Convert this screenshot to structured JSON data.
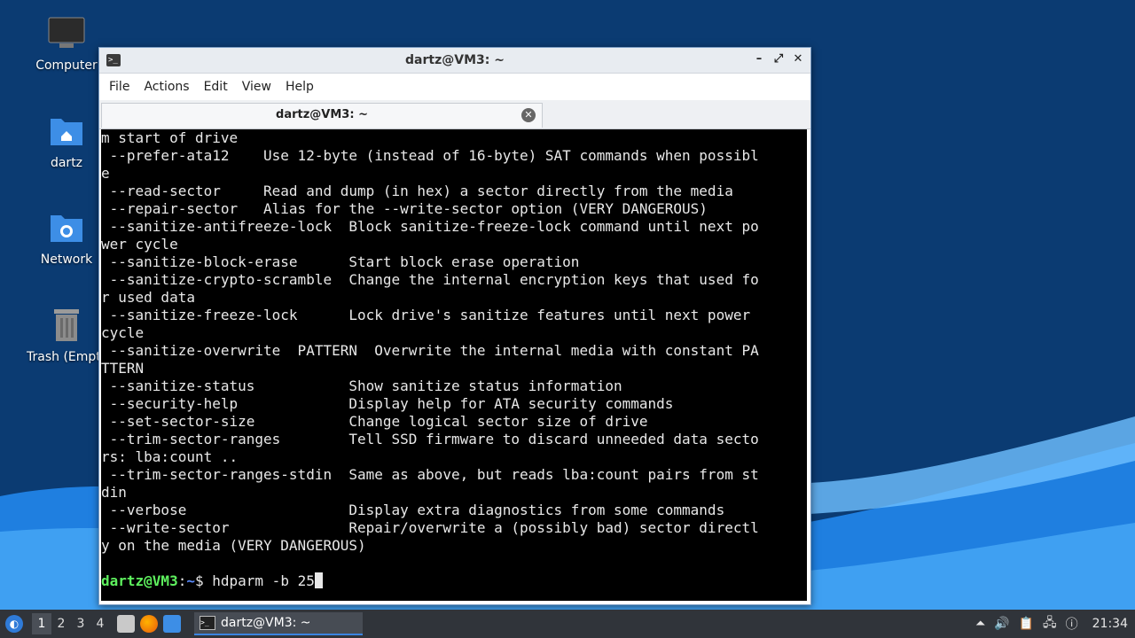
{
  "desktop": {
    "icons": [
      {
        "label": "Computer",
        "icon": "computer-icon"
      },
      {
        "label": "dartz",
        "icon": "home-folder-icon"
      },
      {
        "label": "Network",
        "icon": "network-folder-icon"
      },
      {
        "label": "Trash (Empty)",
        "icon": "trash-icon"
      }
    ]
  },
  "window": {
    "title": "dartz@VM3: ~",
    "menu": [
      "File",
      "Actions",
      "Edit",
      "View",
      "Help"
    ],
    "tab_title": "dartz@VM3: ~",
    "terminal_lines": [
      "m start of drive",
      " --prefer-ata12    Use 12-byte (instead of 16-byte) SAT commands when possibl",
      "e",
      " --read-sector     Read and dump (in hex) a sector directly from the media",
      " --repair-sector   Alias for the --write-sector option (VERY DANGEROUS)",
      " --sanitize-antifreeze-lock  Block sanitize-freeze-lock command until next po",
      "wer cycle",
      " --sanitize-block-erase      Start block erase operation",
      " --sanitize-crypto-scramble  Change the internal encryption keys that used fo",
      "r used data",
      " --sanitize-freeze-lock      Lock drive's sanitize features until next power",
      "cycle",
      " --sanitize-overwrite  PATTERN  Overwrite the internal media with constant PA",
      "TTERN",
      " --sanitize-status           Show sanitize status information",
      " --security-help             Display help for ATA security commands",
      " --set-sector-size           Change logical sector size of drive",
      " --trim-sector-ranges        Tell SSD firmware to discard unneeded data secto",
      "rs: lba:count ..",
      " --trim-sector-ranges-stdin  Same as above, but reads lba:count pairs from st",
      "din",
      " --verbose                   Display extra diagnostics from some commands",
      " --write-sector              Repair/overwrite a (possibly bad) sector directl",
      "y on the media (VERY DANGEROUS)",
      ""
    ],
    "prompt": {
      "user_host": "dartz@VM3",
      "sep": ":",
      "path": "~",
      "symbol": "$ ",
      "command": "hdparm -b 25"
    }
  },
  "taskbar": {
    "workspaces": [
      "1",
      "2",
      "3",
      "4"
    ],
    "active_workspace": "1",
    "task_label": "dartz@VM3: ~",
    "clock": "21:34"
  }
}
